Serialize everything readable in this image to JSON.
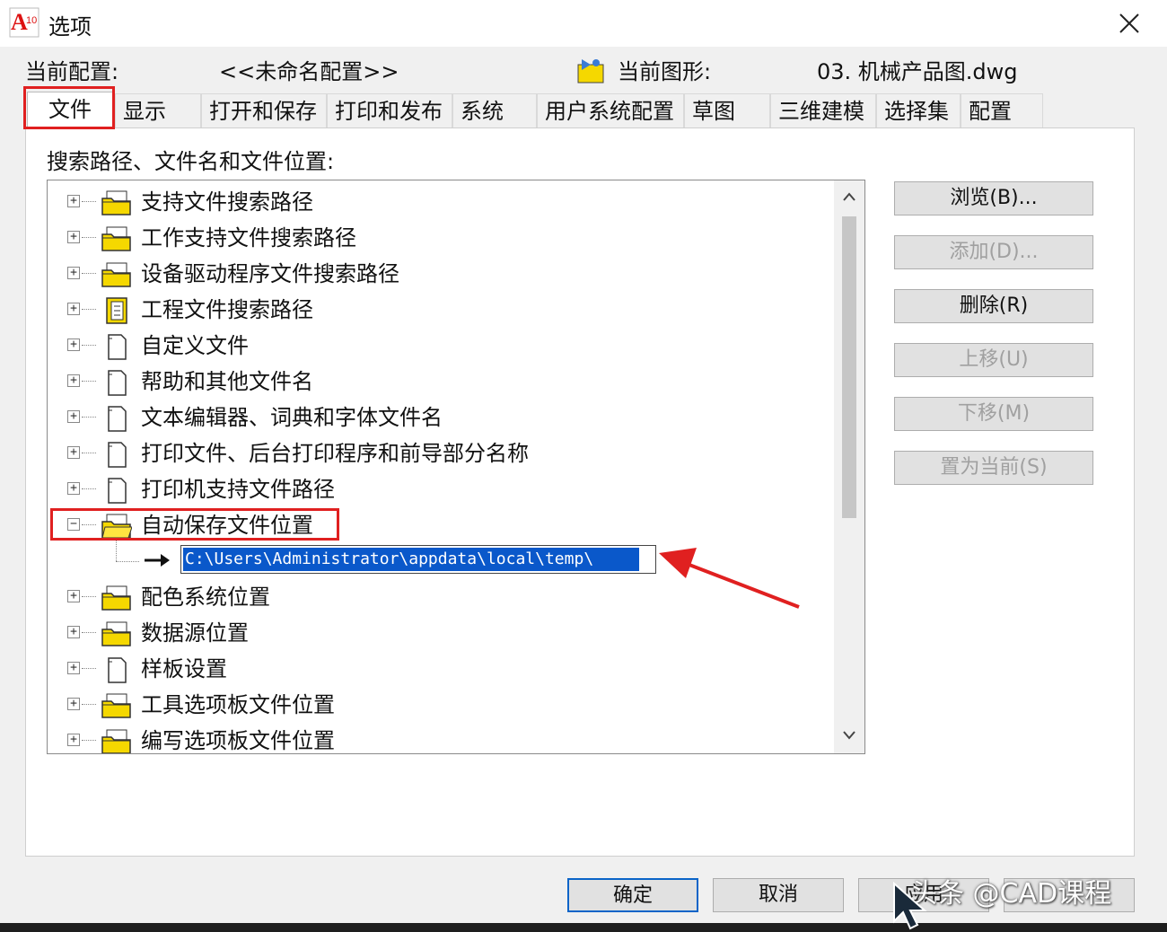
{
  "window": {
    "title": "选项",
    "logo_text": "A",
    "logo_badge": "10"
  },
  "config": {
    "current_profile_label": "当前配置:",
    "current_profile_value": "<<未命名配置>>",
    "current_drawing_label": "当前图形:",
    "current_drawing_value": "03. 机械产品图.dwg"
  },
  "tabs": [
    {
      "label": "文件",
      "active": true
    },
    {
      "label": "显示"
    },
    {
      "label": "打开和保存"
    },
    {
      "label": "打印和发布"
    },
    {
      "label": "系统"
    },
    {
      "label": "用户系统配置"
    },
    {
      "label": "草图"
    },
    {
      "label": "三维建模"
    },
    {
      "label": "选择集"
    },
    {
      "label": "配置"
    }
  ],
  "files_panel": {
    "label": "搜索路径、文件名和文件位置:",
    "tree": [
      {
        "label": "支持文件搜索路径",
        "icon": "folder-stack-icon",
        "expander": "+"
      },
      {
        "label": "工作支持文件搜索路径",
        "icon": "folder-stack-icon",
        "expander": "+"
      },
      {
        "label": "设备驱动程序文件搜索路径",
        "icon": "folder-stack-icon",
        "expander": "+"
      },
      {
        "label": "工程文件搜索路径",
        "icon": "binder-icon",
        "expander": "+"
      },
      {
        "label": "自定义文件",
        "icon": "document-icon",
        "expander": "+"
      },
      {
        "label": "帮助和其他文件名",
        "icon": "document-icon",
        "expander": "+"
      },
      {
        "label": "文本编辑器、词典和字体文件名",
        "icon": "document-icon",
        "expander": "+"
      },
      {
        "label": "打印文件、后台打印程序和前导部分名称",
        "icon": "document-icon",
        "expander": "+"
      },
      {
        "label": "打印机支持文件路径",
        "icon": "document-icon",
        "expander": "+"
      },
      {
        "label": "自动保存文件位置",
        "icon": "folder-open-icon",
        "expander": "−"
      },
      {
        "label": "配色系统位置",
        "icon": "folder-stack-icon",
        "expander": "+"
      },
      {
        "label": "数据源位置",
        "icon": "folder-stack-icon",
        "expander": "+"
      },
      {
        "label": "样板设置",
        "icon": "document-icon",
        "expander": "+"
      },
      {
        "label": "工具选项板文件位置",
        "icon": "folder-stack-icon",
        "expander": "+"
      },
      {
        "label": "编写选项板文件位置",
        "icon": "folder-stack-icon",
        "expander": "+"
      }
    ],
    "autosave_path": "C:\\Users\\Administrator\\appdata\\local\\temp\\"
  },
  "side_buttons": [
    {
      "label": "浏览(B)...",
      "enabled": true
    },
    {
      "label": "添加(D)...",
      "enabled": false
    },
    {
      "label": "删除(R)",
      "enabled": true
    },
    {
      "label": "上移(U)",
      "enabled": false
    },
    {
      "label": "下移(M)",
      "enabled": false
    },
    {
      "label": "置为当前(S)",
      "enabled": false
    }
  ],
  "bottom_buttons": {
    "ok": "确定",
    "cancel": "取消",
    "apply": "应用"
  },
  "watermark": "头条 @CAD课程",
  "colors": {
    "highlight": "#e02020",
    "selection": "#0a58ca",
    "folder": "#f5d800"
  }
}
